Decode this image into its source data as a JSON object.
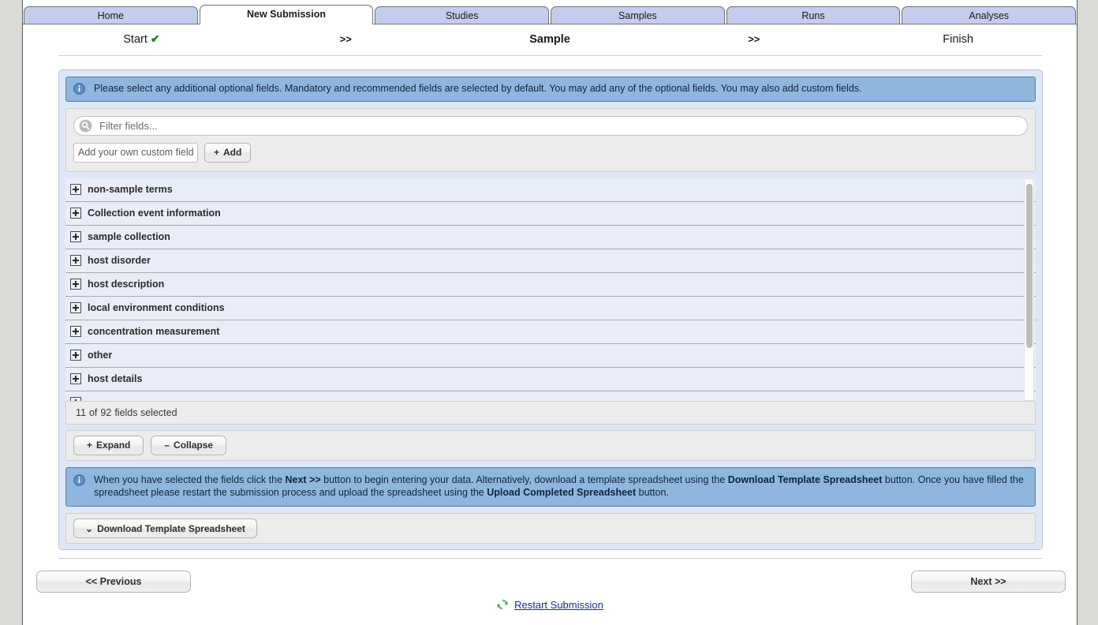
{
  "tabs": [
    {
      "label": "Home",
      "active": false
    },
    {
      "label": "New Submission",
      "active": true
    },
    {
      "label": "Studies",
      "active": false
    },
    {
      "label": "Samples",
      "active": false
    },
    {
      "label": "Runs",
      "active": false
    },
    {
      "label": "Analyses",
      "active": false
    }
  ],
  "steps": {
    "start": "Start",
    "sep1": ">>",
    "sample": "Sample",
    "sep2": ">>",
    "finish": "Finish",
    "start_check_icon": "check-icon"
  },
  "info_top": {
    "icon": "info-icon",
    "text": "Please select any additional optional fields. Mandatory and recommended fields are selected by default. You may add any of the optional fields. You may also add custom fields."
  },
  "toolbar": {
    "filter_placeholder": "Filter fields...",
    "filter_value": "",
    "search_icon": "search-icon",
    "custom_placeholder": "Add your own custom field",
    "custom_value": "",
    "add_label": "Add",
    "add_glyph": "+"
  },
  "groups": [
    {
      "label": "non-sample terms"
    },
    {
      "label": "Collection event information"
    },
    {
      "label": "sample collection"
    },
    {
      "label": "host disorder"
    },
    {
      "label": "host description"
    },
    {
      "label": "local environment conditions"
    },
    {
      "label": "concentration measurement"
    },
    {
      "label": "other"
    },
    {
      "label": "host details"
    },
    {
      "label": ""
    }
  ],
  "count": {
    "selected": "11",
    "of": "of",
    "total": "92",
    "suffix": "fields selected"
  },
  "actions": {
    "expand_label": "Expand",
    "expand_glyph": "+",
    "collapse_label": "Collapse",
    "collapse_glyph": "–"
  },
  "info_bottom": {
    "icon": "info-icon",
    "part1": "When you have selected the fields click the ",
    "bold1": "Next >>",
    "part2": " button to begin entering your data. Alternatively, download a template spreadsheet using the ",
    "bold2": "Download Template Spreadsheet",
    "part3": " button. Once you have filled the spreadsheet please restart the submission process and upload the spreadsheet using the ",
    "bold3": "Upload Completed Spreadsheet",
    "part4": " button."
  },
  "download": {
    "label": "Download Template Spreadsheet",
    "glyph": "⌄"
  },
  "nav": {
    "previous": "<< Previous",
    "next": "Next >>"
  },
  "restart": {
    "icon": "refresh-icon",
    "label": "Restart Submission"
  },
  "colors": {
    "tab_inactive": "#c4cdee",
    "tab_active": "#ffffff",
    "panel": "#dfe7f6",
    "info_banner": "#8fb7de",
    "info_banner_border": "#4f7fb0",
    "toolbar": "#ececec",
    "list_bg": "#e9edf8",
    "check_green": "#118811",
    "link_blue": "#1f2d8a",
    "page_bg": "#d9d9d6"
  }
}
